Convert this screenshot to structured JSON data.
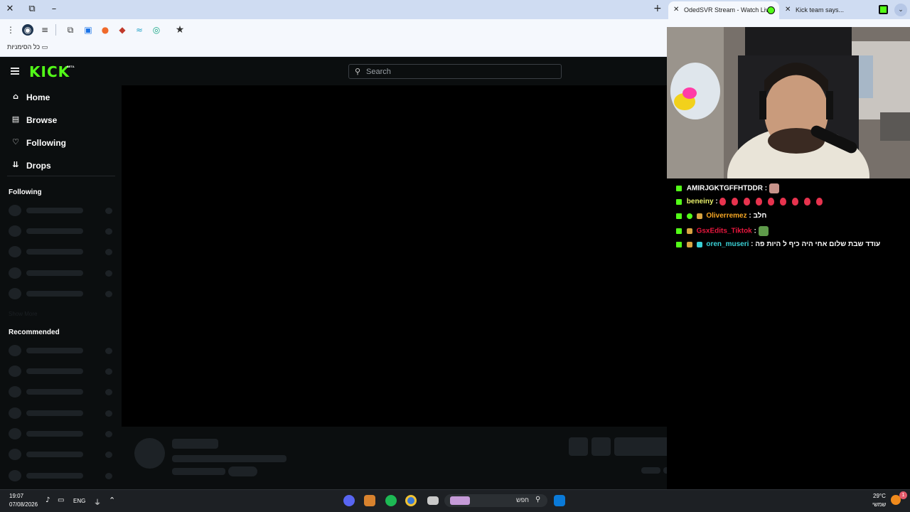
{
  "browser": {
    "window_controls": {
      "close": "✕",
      "restore": "⧉",
      "minimize": "–"
    },
    "new_tab_label": "+",
    "tabs": [
      {
        "title": "OdedSVR Stream - Watch Live"
      },
      {
        "title": "Kick team says..."
      }
    ],
    "bookmarks_label": "כל הסימניות"
  },
  "kick": {
    "logo_text": "KICK",
    "logo_badge": "BETA",
    "search": {
      "placeholder": "Search"
    },
    "nav": [
      {
        "label": "Home",
        "icon": "home-icon",
        "glyph": "⌂"
      },
      {
        "label": "Browse",
        "icon": "browse-icon",
        "glyph": "▤"
      },
      {
        "label": "Following",
        "icon": "heart-icon",
        "glyph": "♡"
      },
      {
        "label": "Drops",
        "icon": "drops-icon",
        "glyph": "⇊"
      }
    ],
    "following_header": "Following",
    "show_more": "Show More",
    "recommended_header": "Recommended",
    "accent_color": "#53fc18"
  },
  "chat": {
    "messages": [
      {
        "user": "AMIRJGKTGFFHTDDR",
        "user_color": "#ffffff",
        "text": ""
      },
      {
        "user": "beneiny",
        "user_color": "#e8f06a",
        "text": ""
      },
      {
        "user": "Oliverremez",
        "user_color": "#f5a623",
        "text": "חלב"
      },
      {
        "user": "GsxEdits_Tiktok",
        "user_color": "#e8173e",
        "text": ""
      },
      {
        "user": "oren_museri",
        "user_color": "#3ad1d6",
        "text": "עודד שבת שלום אחי היה כיף ל היות פה"
      }
    ]
  },
  "taskbar": {
    "time": "19:07",
    "date": "07/08/2026",
    "language": "ENG",
    "search_placeholder": "חפש",
    "weather_temp": "29°C",
    "weather_desc": "שמשי",
    "notification_count": "1"
  }
}
